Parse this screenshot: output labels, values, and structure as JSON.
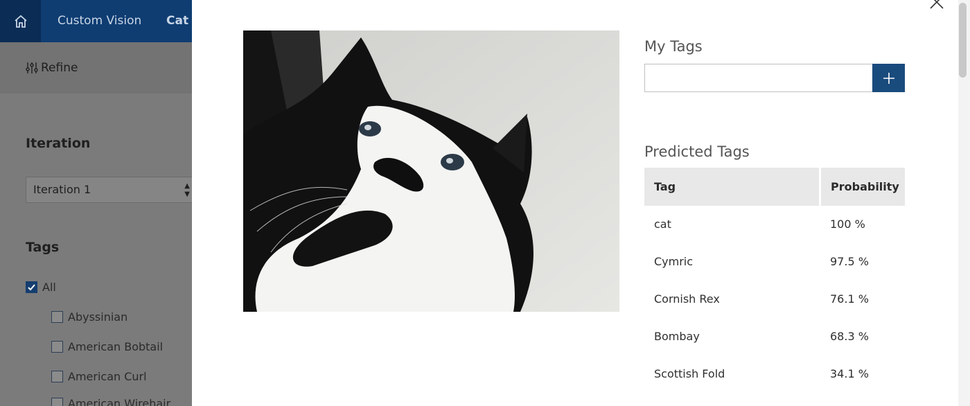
{
  "topbar": {
    "app_name": "Custom Vision",
    "project_name": "Cat B"
  },
  "sidebar": {
    "refine_label": "Refine",
    "iteration_heading": "Iteration",
    "iteration_value": "Iteration 1",
    "tags_heading": "Tags",
    "tags": [
      {
        "label": "All",
        "checked": true
      },
      {
        "label": "Abyssinian",
        "checked": false
      },
      {
        "label": "American Bobtail",
        "checked": false
      },
      {
        "label": "American Curl",
        "checked": false
      },
      {
        "label": "American Wirehair",
        "checked": false
      }
    ]
  },
  "modal": {
    "my_tags_title": "My Tags",
    "tag_input_value": "",
    "predicted_title": "Predicted Tags",
    "table": {
      "headers": [
        "Tag",
        "Probability"
      ],
      "rows": [
        {
          "tag": "cat",
          "probability": "100 %"
        },
        {
          "tag": "Cymric",
          "probability": "97.5 %"
        },
        {
          "tag": "Cornish Rex",
          "probability": "76.1 %"
        },
        {
          "tag": "Bombay",
          "probability": "68.3 %"
        },
        {
          "tag": "Scottish Fold",
          "probability": "34.1 %"
        }
      ]
    }
  },
  "colors": {
    "topbar": "#0f3d72",
    "add_button": "#1a4b7d",
    "header_bg": "#e8e8e8",
    "sidebar_dimmed": "#7b7b7b"
  },
  "icons": [
    "home-icon",
    "refine-sliders-icon",
    "select-arrows-icon",
    "checkbox-checked-icon",
    "plus-icon",
    "close-icon"
  ]
}
